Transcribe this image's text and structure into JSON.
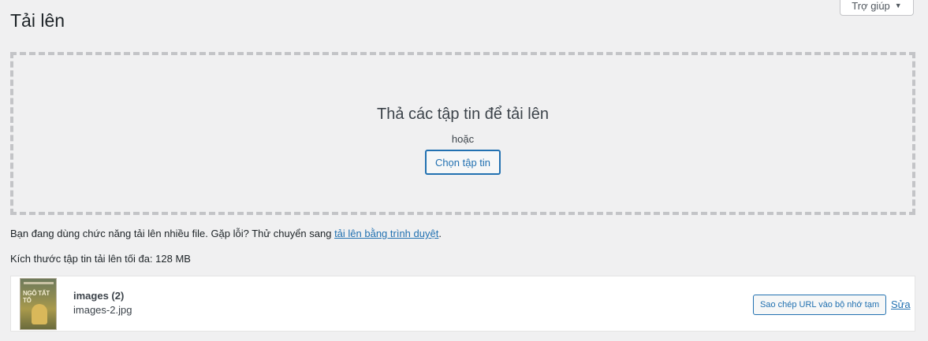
{
  "header": {
    "title": "Tải lên",
    "help_label": "Trợ giúp"
  },
  "dropzone": {
    "title": "Thả các tập tin để tải lên",
    "or_text": "hoặc",
    "select_button": "Chọn tập tin"
  },
  "info": {
    "multi_prefix": "Bạn đang dùng chức năng tải lên nhiều file. Gặp lỗi? Thử chuyển sang ",
    "browser_link": "tải lên bằng trình duyệt",
    "multi_suffix": ".",
    "max_size": "Kích thước tập tin tải lên tối đa: 128 MB"
  },
  "upload_item": {
    "title": "images (2)",
    "filename": "images-2.jpg",
    "thumb_text": "NGÔ TẤT TỐ",
    "copy_url_button": "Sao chép URL vào bộ nhớ tạm",
    "edit_link": "Sửa"
  },
  "colors": {
    "accent": "#2271b1",
    "background": "#f0f0f1",
    "border_dashed": "#c3c4c7"
  },
  "icons": {
    "help_caret": "caret-down-icon"
  }
}
